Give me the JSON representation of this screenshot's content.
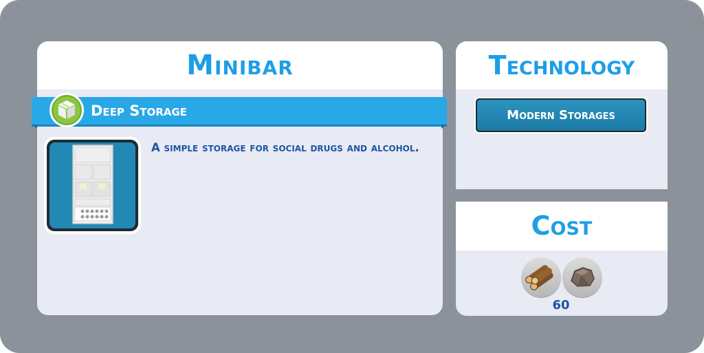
{
  "item": {
    "title": "Minibar",
    "category": "Deep Storage",
    "category_icon": "storage-box-icon",
    "image": "minibar-icon",
    "description": "A simple storage for social drugs and alcohol."
  },
  "technology": {
    "title": "Technology",
    "required": "Modern Storages"
  },
  "cost": {
    "title": "Cost",
    "resources": [
      {
        "name": "wood-log-icon"
      },
      {
        "name": "stone-icon"
      }
    ],
    "value": "60"
  },
  "colors": {
    "accent": "#1e9ee6",
    "ribbon": "#29a8e8",
    "text_dark": "#1f55a3",
    "panel": "#e8ebf4",
    "background": "#8b9299",
    "category_green": "#8cc63f"
  }
}
